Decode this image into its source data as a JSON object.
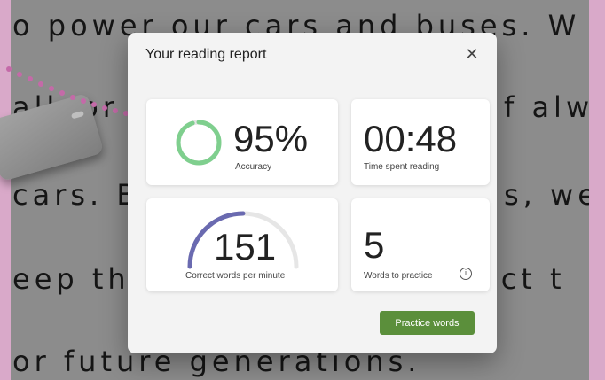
{
  "background": {
    "lines": [
      "o power our cars and buses. W",
      "alk or",
      "f alw",
      "cars. B",
      "s, we",
      "eep th",
      "ect t",
      "or future generations."
    ]
  },
  "dialog": {
    "title": "Your reading report",
    "close_icon": "close-icon"
  },
  "stats": {
    "accuracy": {
      "value": "95%",
      "label": "Accuracy",
      "fraction": 0.95
    },
    "time": {
      "value": "00:48",
      "label": "Time spent reading"
    },
    "wpm": {
      "value": "151",
      "label": "Correct words per minute"
    },
    "words": {
      "value": "5",
      "label": "Words to practice",
      "info_icon": "i"
    }
  },
  "actions": {
    "practice_label": "Practice words"
  },
  "colors": {
    "accent_green": "#5b8f3b",
    "ring_green": "#7fcf8e",
    "arc_purple": "#6a6ab0",
    "pointer_pink": "#c46aa8"
  }
}
